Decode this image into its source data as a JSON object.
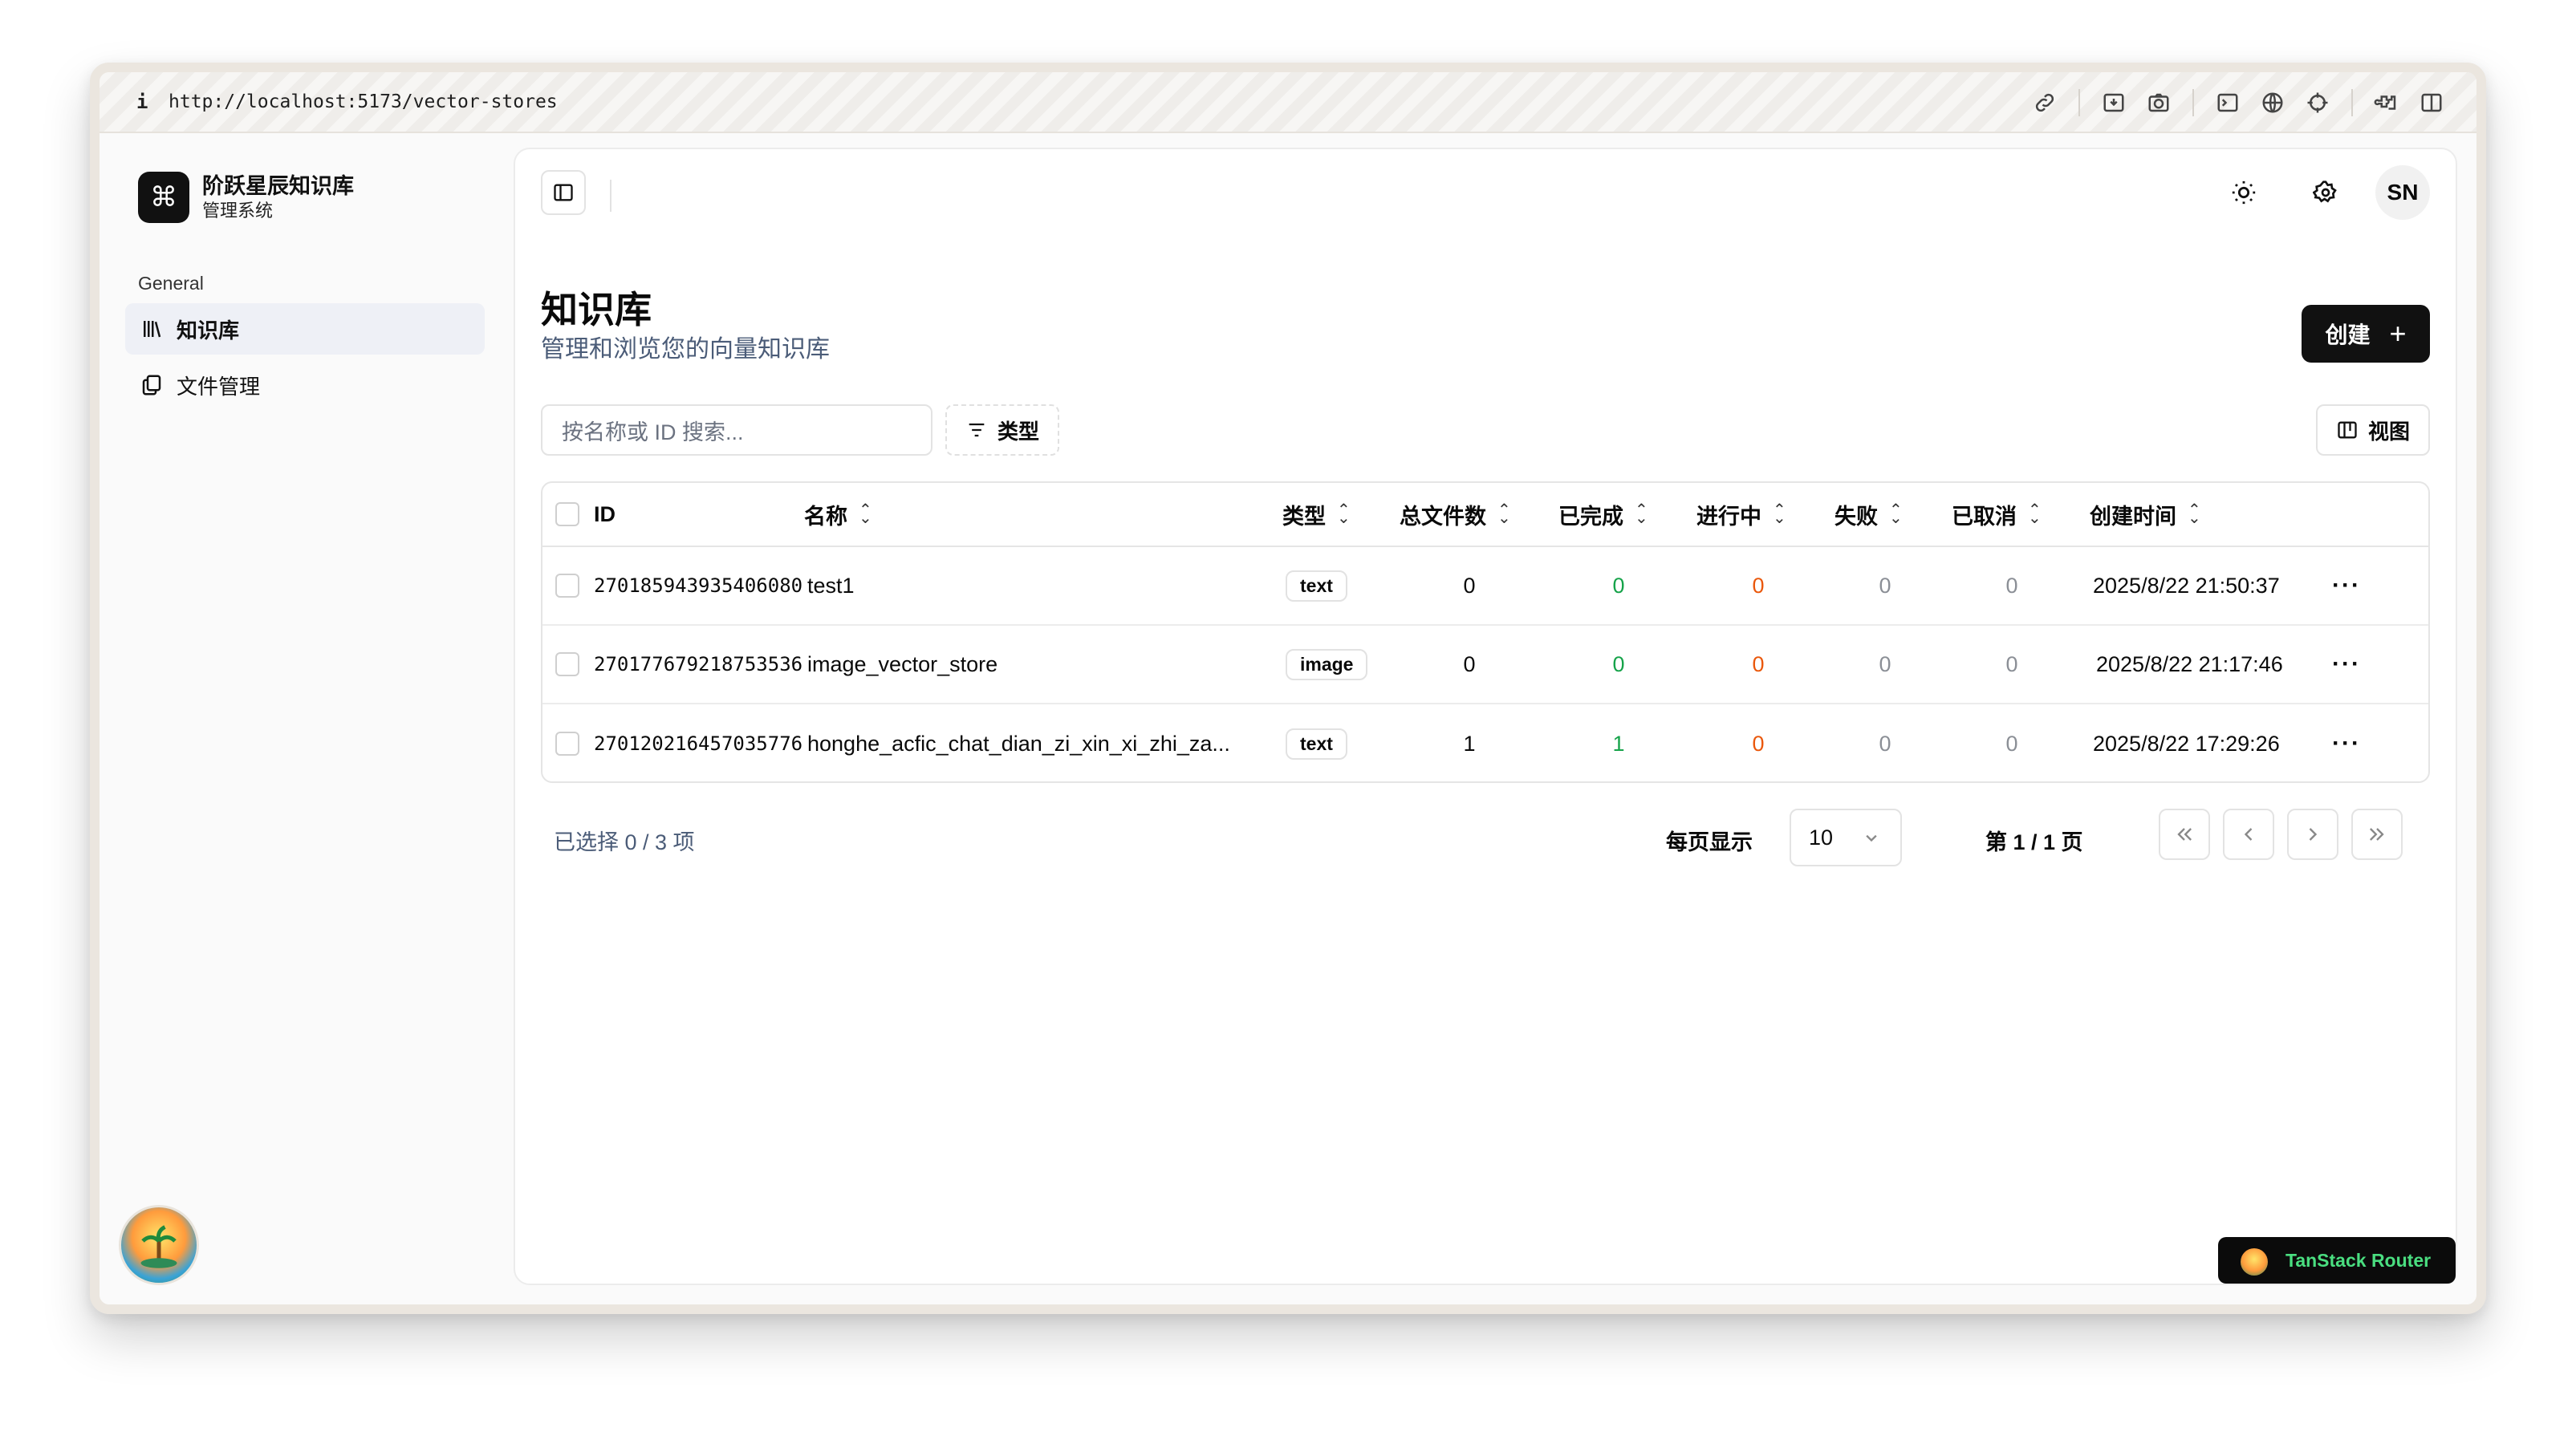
{
  "browser": {
    "info_icon": "i",
    "url": "http://localhost:5173/vector-stores",
    "tools": [
      "link-icon",
      "download-icon",
      "camera-icon",
      "terminal-icon",
      "globe-icon",
      "crosshair-icon",
      "extensions-icon",
      "sidebar-icon"
    ]
  },
  "sidebar": {
    "brand_logo": "⌘",
    "brand_title": "阶跃星辰知识库",
    "brand_sub": "管理系统",
    "group_label": "General",
    "items": [
      {
        "label": "知识库",
        "icon": "library-icon",
        "active": true
      },
      {
        "label": "文件管理",
        "icon": "files-icon",
        "active": false
      }
    ]
  },
  "header": {
    "avatar": "SN"
  },
  "main": {
    "title": "知识库",
    "subtitle": "管理和浏览您的向量知识库",
    "create_label": "创建",
    "create_icon": "+",
    "search_placeholder": "按名称或 ID 搜索...",
    "type_filter_label": "类型",
    "view_label": "视图"
  },
  "table": {
    "columns": [
      "ID",
      "名称",
      "类型",
      "总文件数",
      "已完成",
      "进行中",
      "失败",
      "已取消",
      "创建时间"
    ],
    "rows": [
      {
        "id": "270185943935406080",
        "name": "test1",
        "type": "text",
        "total": "0",
        "done": "0",
        "running": "0",
        "failed": "0",
        "cancelled": "0",
        "created": "2025/8/22 21:50:37"
      },
      {
        "id": "270177679218753536",
        "name": "image_vector_store",
        "type": "image",
        "total": "0",
        "done": "0",
        "running": "0",
        "failed": "0",
        "cancelled": "0",
        "created": "2025/8/22 21:17:46"
      },
      {
        "id": "270120216457035776",
        "name": "honghe_acfic_chat_dian_zi_xin_xi_zhi_za...",
        "type": "text",
        "total": "1",
        "done": "1",
        "running": "0",
        "failed": "0",
        "cancelled": "0",
        "created": "2025/8/22 17:29:26"
      }
    ],
    "row_menu": "···"
  },
  "footer": {
    "selection": "已选择 0 / 3 项",
    "per_page_label": "每页显示",
    "per_page_value": "10",
    "page_info": "第 1 / 1 页",
    "nav": [
      "«",
      "‹",
      "›",
      "»"
    ]
  },
  "devtools": {
    "label": "TanStack Router"
  },
  "colors": {
    "accent": "#111111",
    "done": "#16a34a",
    "running": "#ea580c",
    "muted": "#8b8f96",
    "subtitle": "#4b5c78"
  }
}
